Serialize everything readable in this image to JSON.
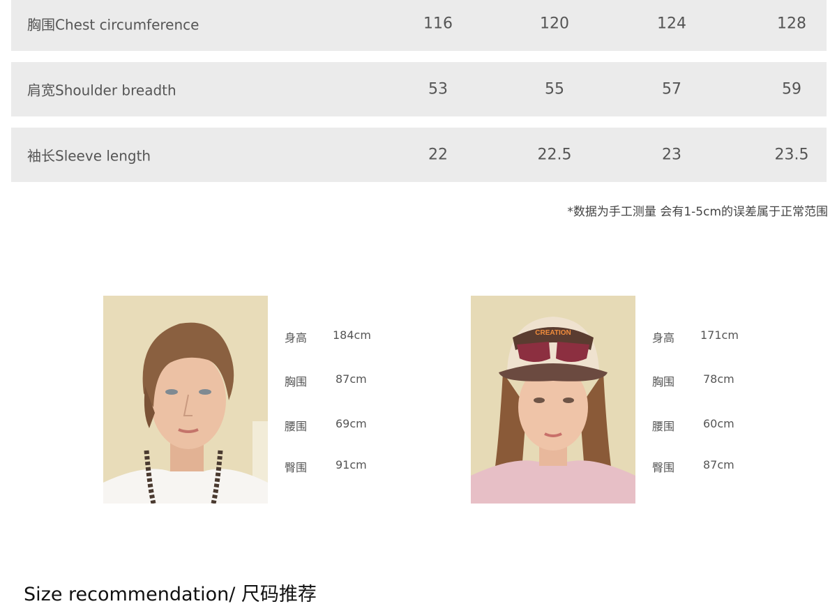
{
  "size_table": {
    "rows": [
      {
        "label": "胸围Chest circumference",
        "values": [
          "116",
          "120",
          "124",
          "128"
        ]
      },
      {
        "label": "肩宽Shoulder breadth",
        "values": [
          "53",
          "55",
          "57",
          "59"
        ]
      },
      {
        "label": "袖长Sleeve length",
        "values": [
          "22",
          "22.5",
          "23",
          "23.5"
        ]
      }
    ],
    "note": "*数据为手工测量 会有1-5cm的误差属于正常范围"
  },
  "models": [
    {
      "stats": [
        {
          "label": "身高",
          "value": "184cm"
        },
        {
          "label": "胸围",
          "value": "87cm"
        },
        {
          "label": "腰围",
          "value": "69cm"
        },
        {
          "label": "臀围",
          "value": "91cm"
        }
      ]
    },
    {
      "stats": [
        {
          "label": "身高",
          "value": "171cm"
        },
        {
          "label": "胸围",
          "value": "78cm"
        },
        {
          "label": "腰围",
          "value": "60cm"
        },
        {
          "label": "臀围",
          "value": "87cm"
        }
      ]
    }
  ],
  "section_title": "Size recommendation/ 尺码推荐"
}
